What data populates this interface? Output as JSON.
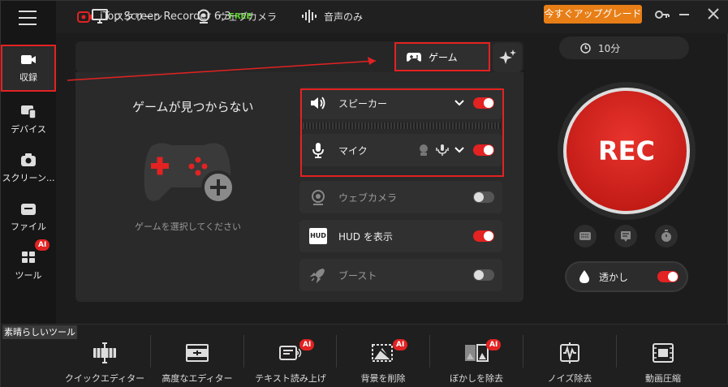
{
  "app": {
    "title": "iTop Screen Recorder 6.3",
    "edition": "FREE",
    "upgrade_label": "今すぐアップグレード"
  },
  "sidebar": {
    "items": [
      {
        "label": "収録",
        "icon": "video-camera-icon",
        "active": true
      },
      {
        "label": "デバイス",
        "icon": "devices-icon"
      },
      {
        "label": "スクリーン...",
        "icon": "camera-icon"
      },
      {
        "label": "ファイル",
        "icon": "folder-icon"
      },
      {
        "label": "ツール",
        "icon": "tools-icon",
        "badge": "AI"
      }
    ]
  },
  "tabs": [
    {
      "label": "スクリーン",
      "icon": "monitor-icon"
    },
    {
      "label": "ウェブカメラ",
      "icon": "webcam-icon"
    },
    {
      "label": "音声のみ",
      "icon": "waveform-icon"
    },
    {
      "label": "ゲーム",
      "icon": "gamepad-icon",
      "active": true
    }
  ],
  "game": {
    "title": "ゲームが見つからない",
    "hint": "ゲームを選択してください"
  },
  "options": {
    "speaker": {
      "label": "スピーカー",
      "on": true
    },
    "mic": {
      "label": "マイク",
      "on": true
    },
    "webcam": {
      "label": "ウェブカメラ",
      "on": false
    },
    "hud": {
      "label": "HUD を表示",
      "icon_text": "HUD",
      "on": true
    },
    "boost": {
      "label": "ブースト",
      "on": false
    }
  },
  "right": {
    "duration": "10分",
    "rec_label": "REC",
    "watermark_label": "透かし",
    "watermark_on": true
  },
  "tools": {
    "section_label": "素晴らしいツール",
    "items": [
      {
        "label": "クイックエディター",
        "icon": "quick-editor-icon"
      },
      {
        "label": "高度なエディター",
        "icon": "advanced-editor-icon"
      },
      {
        "label": "テキスト読み上げ",
        "icon": "text-to-speech-icon",
        "badge": "AI"
      },
      {
        "label": "背景を削除",
        "icon": "remove-background-icon",
        "badge": "AI"
      },
      {
        "label": "ぼかしを除去",
        "icon": "unblur-icon",
        "badge": "AI"
      },
      {
        "label": "ノイズ除去",
        "icon": "noise-removal-icon"
      },
      {
        "label": "動画圧縮",
        "icon": "video-compress-icon"
      }
    ]
  },
  "colors": {
    "accent": "#e32222",
    "upgrade": "#e87e16",
    "free": "#5dd12a"
  }
}
